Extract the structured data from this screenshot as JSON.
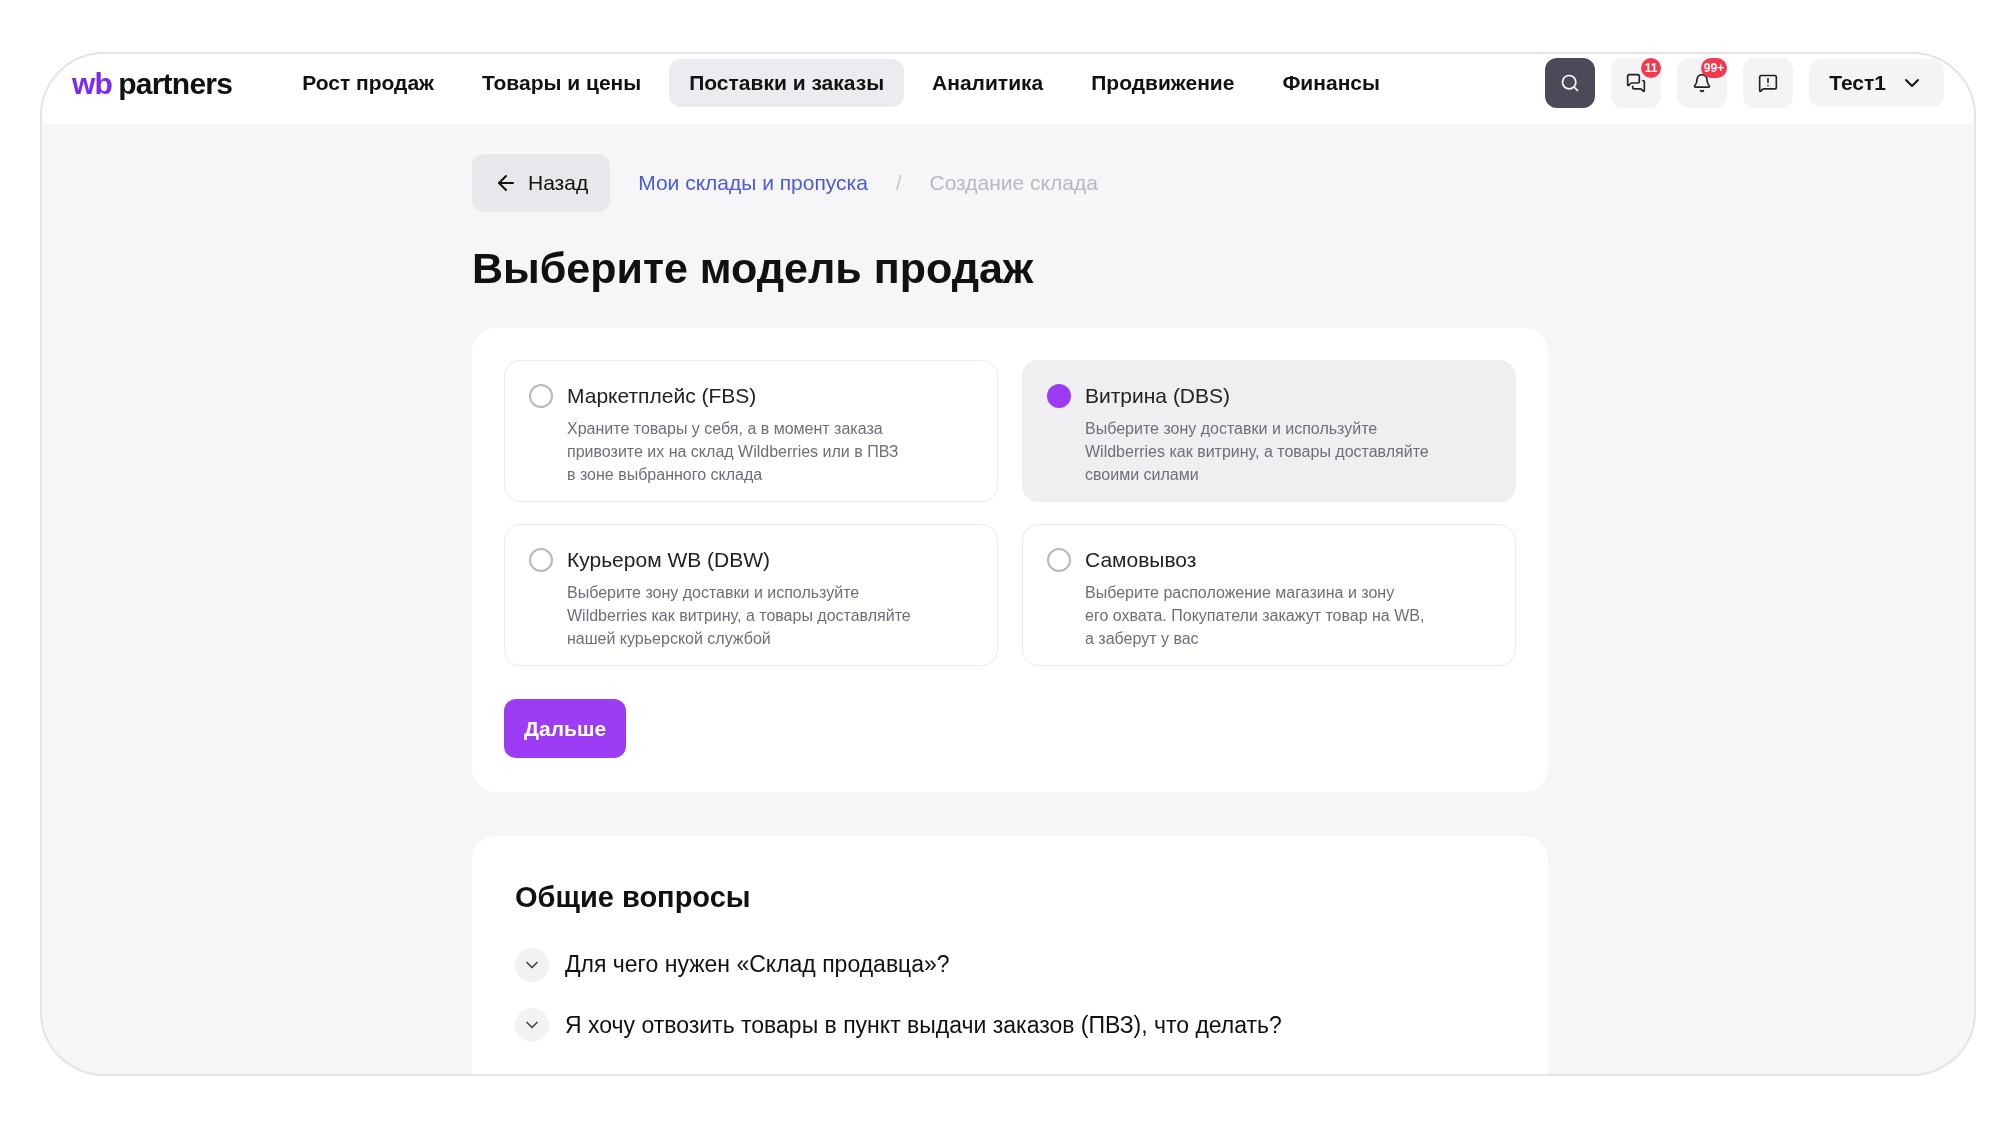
{
  "header": {
    "logo": {
      "brand": "wb",
      "name": "partners"
    },
    "nav": [
      {
        "label": "Рост продаж",
        "selected": false
      },
      {
        "label": "Товары и цены",
        "selected": false
      },
      {
        "label": "Поставки и заказы",
        "selected": true
      },
      {
        "label": "Аналитика",
        "selected": false
      },
      {
        "label": "Продвижение",
        "selected": false
      },
      {
        "label": "Финансы",
        "selected": false
      }
    ],
    "actions": [
      {
        "kind": "search"
      },
      {
        "kind": "chat",
        "badge": "11"
      },
      {
        "kind": "bell",
        "badge": "99+"
      },
      {
        "kind": "help"
      }
    ],
    "user": "Тест1"
  },
  "back_button": "Назад",
  "breadcrumbs": [
    {
      "label": "Мои склады и пропуска",
      "kind": "link"
    },
    {
      "label": "Создание склада",
      "kind": "current"
    }
  ],
  "breadcrumb_separator": "/",
  "title": "Выберите модель продаж",
  "options": [
    {
      "title": "Маркетплейс (FBS)",
      "lines": [
        "Храните товары у себя, а в момент заказа",
        "привозите их на склад Wildberries или в ПВЗ",
        "в зоне выбранного склада"
      ],
      "selected": false
    },
    {
      "title": "Витрина (DBS)",
      "lines": [
        "Выберите зону доставки и используйте",
        "Wildberries как витрину, а товары доставляйте",
        "своими силами"
      ],
      "selected": true
    },
    {
      "title": "Курьером WB (DBW)",
      "lines": [
        "Выберите зону доставки и используйте",
        "Wildberries как витрину, а товары доставляйте",
        "нашей курьерской службой"
      ],
      "selected": false
    },
    {
      "title": "Самовывоз",
      "lines": [
        "Выберите расположение магазина и зону",
        "его охвата. Покупатели закажут товар на WB,",
        "а заберут у вас"
      ],
      "selected": false
    }
  ],
  "next_button": "Дальше",
  "faq": {
    "title": "Общие вопросы",
    "items": [
      {
        "question": "Для чего нужен «Склад продавца»?",
        "expanded": false
      },
      {
        "question": "Я хочу отвозить товары в пункт выдачи заказов (ПВЗ), что делать?",
        "expanded": false
      }
    ]
  }
}
